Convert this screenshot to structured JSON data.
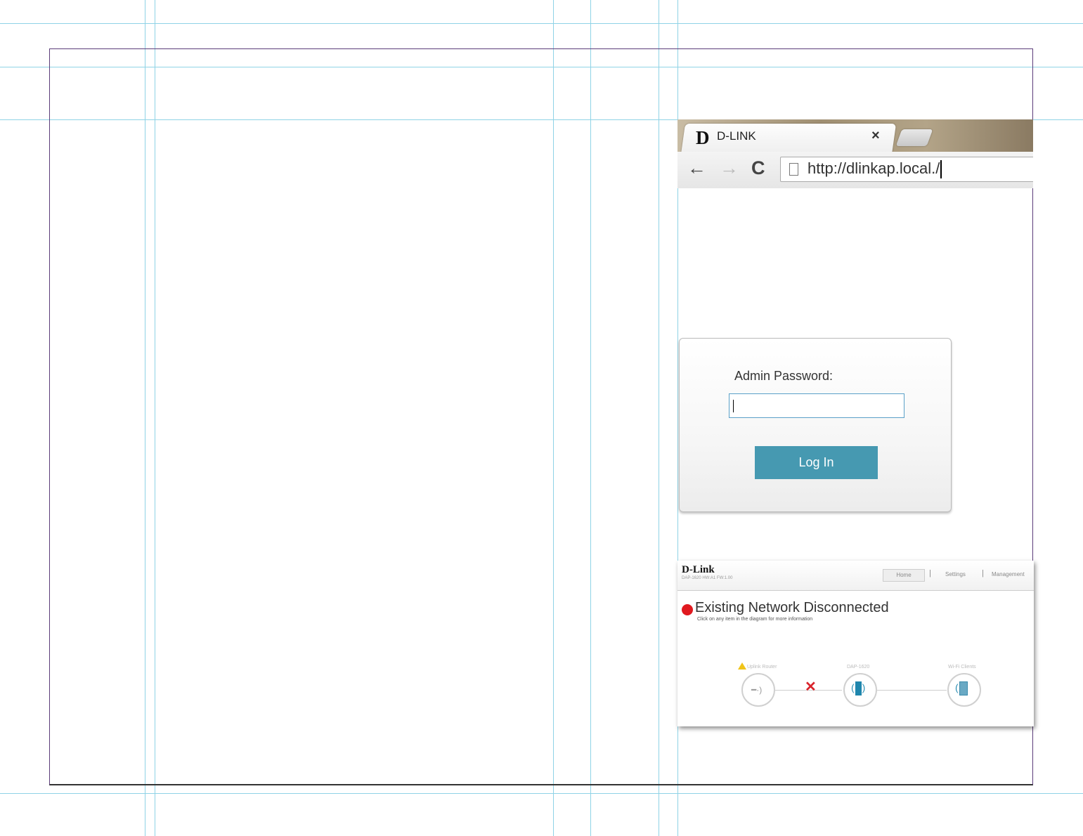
{
  "browser": {
    "tab_logo": "D",
    "tab_title": "D-LINK",
    "tab_close": "×",
    "back_icon": "←",
    "forward_icon": "→",
    "reload_icon": "C",
    "url": "http://dlinkap.local./"
  },
  "login": {
    "password_label": "Admin Password:",
    "password_value": "",
    "login_button": "Log In",
    "accent_color": "#4699b1"
  },
  "dashboard": {
    "logo": "D-Link",
    "model_line": "DAP-1620 HW:A1 FW:1.00",
    "nav": {
      "home": "Home",
      "settings": "Settings",
      "management": "Management",
      "separator": "|"
    },
    "status_title": "Existing Network Disconnected",
    "status_subtitle": "Click on any item in the diagram for more information",
    "status_color": "#e0191f",
    "nodes": {
      "router_label": "Uplink Router",
      "ap_label": "DAP-1620",
      "clients_label": "Wi-Fi Clients",
      "disconnect_mark": "✕"
    }
  }
}
